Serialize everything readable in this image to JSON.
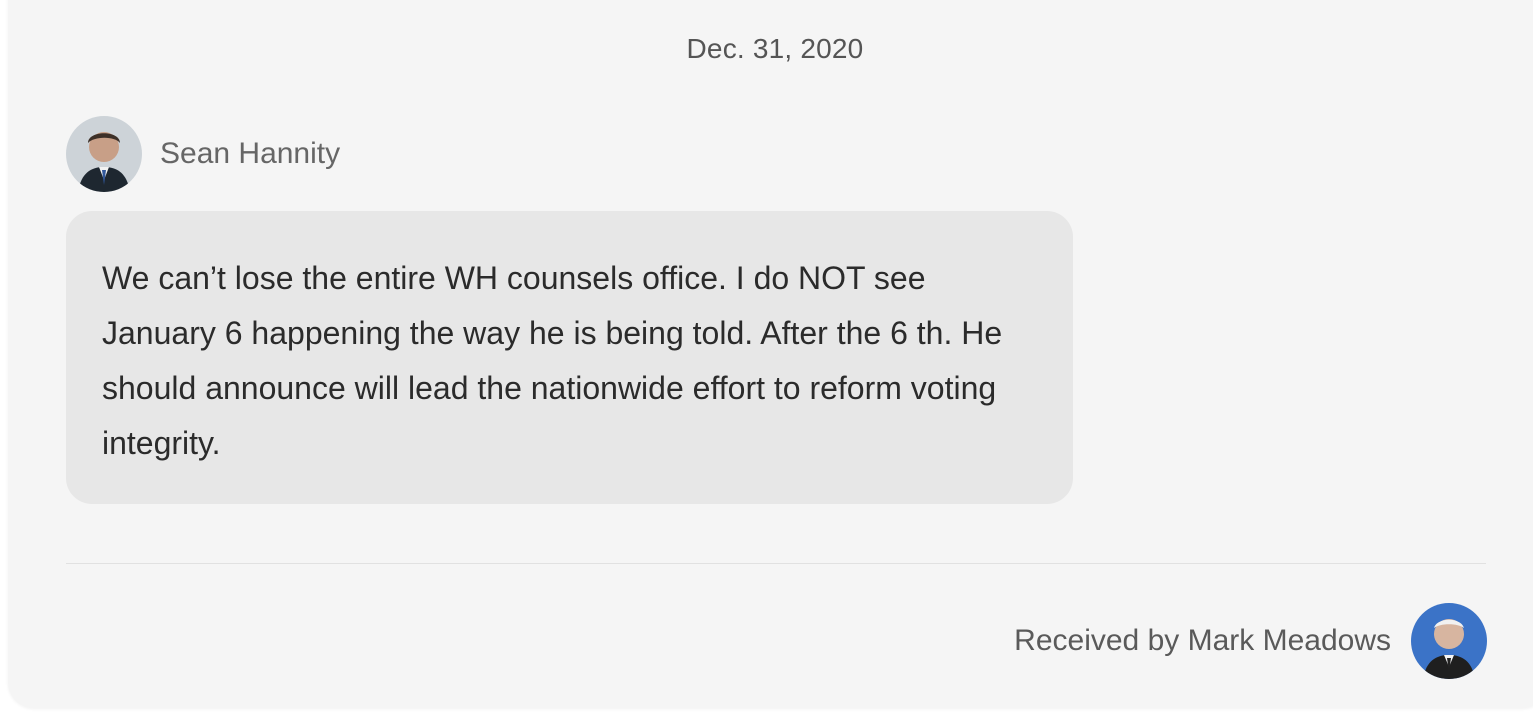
{
  "conversation": {
    "date": "Dec. 31, 2020",
    "sender": {
      "name": "Sean Hannity",
      "avatar_icon": "person-photo-avatar"
    },
    "message": {
      "text": "We can’t lose the entire WH counsels office. I do NOT see January 6 happening the way he is being told. After the 6 th. He should announce will lead the nationwide effort to reform voting integrity."
    },
    "receiver": {
      "label": "Received by Mark Meadows",
      "avatar_icon": "person-photo-avatar"
    }
  },
  "colors": {
    "card_background": "#f5f5f5",
    "bubble_background": "#e7e7e7",
    "text": "#2b2b2b",
    "muted_text": "#666666",
    "divider": "#e1e1e1",
    "receiver_avatar_background": "#3b73c7"
  }
}
